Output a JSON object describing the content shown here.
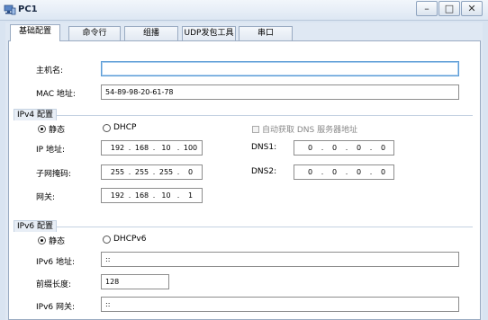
{
  "window": {
    "title": "PC1",
    "minimize_label": "–",
    "maximize_label": "□",
    "close_label": "✕"
  },
  "tabs": [
    {
      "label": "基础配置",
      "active": true
    },
    {
      "label": "命令行",
      "active": false
    },
    {
      "label": "组播",
      "active": false
    },
    {
      "label": "UDP发包工具",
      "active": false
    },
    {
      "label": "串口",
      "active": false
    }
  ],
  "basic": {
    "hostname_label": "主机名:",
    "hostname_value": "",
    "mac_label": "MAC 地址:",
    "mac_value": "54-89-98-20-61-78"
  },
  "ipv4": {
    "section_title": "IPv4 配置",
    "static_label": "静态",
    "dhcp_label": "DHCP",
    "static_selected": true,
    "auto_dns_label": "自动获取 DNS 服务器地址",
    "ip_label": "IP 地址:",
    "ip": [
      "192",
      "168",
      "10",
      "100"
    ],
    "mask_label": "子网掩码:",
    "mask": [
      "255",
      "255",
      "255",
      "0"
    ],
    "gateway_label": "网关:",
    "gateway": [
      "192",
      "168",
      "10",
      "1"
    ],
    "dns1_label": "DNS1:",
    "dns1": [
      "0",
      "0",
      "0",
      "0"
    ],
    "dns2_label": "DNS2:",
    "dns2": [
      "0",
      "0",
      "0",
      "0"
    ]
  },
  "ipv6": {
    "section_title": "IPv6 配置",
    "static_label": "静态",
    "dhcpv6_label": "DHCPv6",
    "static_selected": true,
    "ip_label": "IPv6 地址:",
    "ip_value": "::",
    "prefix_label": "前缀长度:",
    "prefix_value": "128",
    "gateway_label": "IPv6 网关:",
    "gateway_value": "::"
  }
}
